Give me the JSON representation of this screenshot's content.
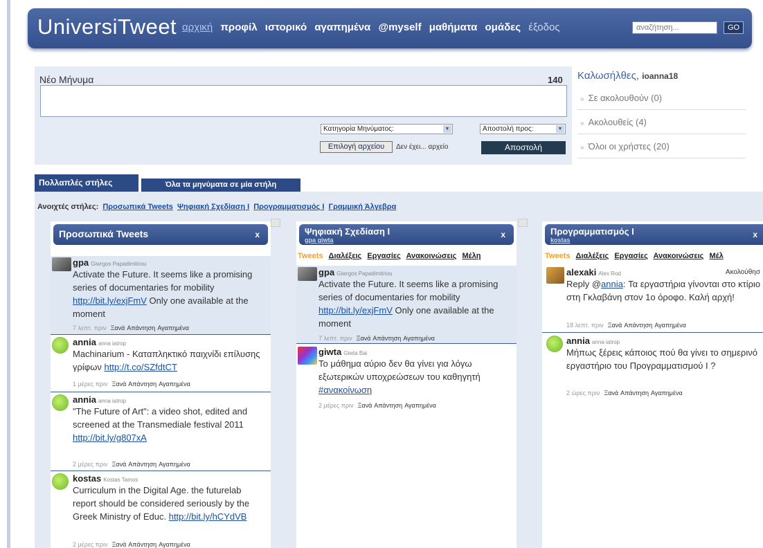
{
  "header": {
    "logo": "UniversiTweet",
    "nav": [
      "αρχική",
      "προφίλ",
      "ιστορικό",
      "αγαπημένα",
      "@myself",
      "μαθήματα",
      "ομάδες",
      "έξοδος"
    ],
    "search_placeholder": "αναζήτηση...",
    "search_button": "GO"
  },
  "compose": {
    "title": "Νέο Μήνυμα",
    "counter": "140",
    "category_select": "Κατηγορία Μηνύματος:",
    "send_to_select": "Αποστολή προς:",
    "file_button": "Επιλογή αρχείου",
    "file_label": "Δεν έχει... αρχείο",
    "send_button": "Αποστολή"
  },
  "welcome": {
    "title": "Καλωσήλθες,",
    "username": "ioanna18",
    "items": [
      "Σε ακολουθούν (0)",
      "Ακολουθείς (4)",
      "Όλοι οι χρήστες (20)"
    ]
  },
  "tabs": {
    "multi": "Πολλαπλές στήλες",
    "single": "Όλα τα μηνύματα σε μία στήλη"
  },
  "open_columns": {
    "label": "Ανοιχτές στήλες:",
    "links": [
      "Προσωπικά Tweets",
      "Ψηφιακή Σχεδίαση Ι",
      "Προγραμματισμός Ι",
      "Γραμμική Άλγεβρα"
    ]
  },
  "actions": {
    "retweet": "Ξανά",
    "reply": "Απάντηση",
    "fav": "Αγαπημένα"
  },
  "col1": {
    "title": "Προσωπικά Tweets",
    "close": "x",
    "tweets": [
      {
        "user": "gpa",
        "fullname": "Giwrgos Papadimitriou",
        "text": "Activate the Future. It seems like a promising series of documentaries for mobility ",
        "link": "http://bit.ly/exjFmV",
        "text_after": " Only one available at the moment",
        "time": "7 λεπτ. πριν"
      },
      {
        "user": "annia",
        "fullname": "anna iatrop",
        "text": "Machinarium - Καταπληκτικό παιχνίδι επίλυσης γρίφων ",
        "link": "http://t.co/SZfdtCT",
        "text_after": "",
        "time": "1 μέρες πριν"
      },
      {
        "user": "annia",
        "fullname": "anna iatrop",
        "text": "\"The Future of Art\": a video shot, edited and screened at the Transmediale festival 2011 ",
        "link": "http://bit.ly/g807xA",
        "text_after": "",
        "time": "2 μέρες πριν"
      },
      {
        "user": "kostas",
        "fullname": "Kostas Tamos",
        "text": "Curriculum in the Digital Age. the futurelab report should be considered seriously by the Greek Ministry of Educ. ",
        "link": "http://bit.ly/hCYdVB",
        "text_after": "",
        "time": "2 μέρες πριν"
      }
    ]
  },
  "col2": {
    "title": "Ψηφιακή Σχεδίαση Ι",
    "members": "gpa  giwta",
    "close": "x",
    "tabs": [
      "Tweets",
      "Διαλέξεις",
      "Εργασίες",
      "Ανακοινώσεις",
      "Μέλη"
    ],
    "tweets": [
      {
        "user": "gpa",
        "fullname": "Giwrgos Papadimitriou",
        "text": "Activate the Future. It seems like a promising series of documentaries for mobility ",
        "link": "http://bit.ly/exjFmV",
        "text_after": " Only one available at the moment",
        "time": "7 λεπτ. πριν"
      },
      {
        "user": "giwta",
        "fullname": "Giwta Bai",
        "text": "Το μάθημα αύριο δεν θα γίνει για λόγω εξωτερικών υποχρεώσεων του καθηγητή ",
        "link": "#ανακοίνωση",
        "text_after": "",
        "time": "2 μέρες πριν"
      }
    ]
  },
  "col3": {
    "title": "Προγραμματισμός Ι",
    "members": "kostas",
    "close": "x",
    "tabs": [
      "Tweets",
      "Διαλέξεις",
      "Εργασίες",
      "Ανακοινώσεις",
      "Μέλ"
    ],
    "tweets": [
      {
        "user": "alexaki",
        "fullname": "Alex Rod",
        "follow": "Ακολούθησ",
        "text_before": "Reply @",
        "mention": "annia",
        "text": ": Τα εργαστήρια γίνονται στο κτίριο στη Γκλαβάνη στον 1ο όροφο. Καλή αρχή!",
        "time": "18 λεπτ. πριν"
      },
      {
        "user": "annia",
        "fullname": "anna iatrop",
        "text": "Μήπως ξέρεις κάποιος πού θα γίνει το σημερινό εργαστήριο του Προγραμματισμού Ι ?",
        "time": "2 ώρες πριν"
      }
    ]
  }
}
